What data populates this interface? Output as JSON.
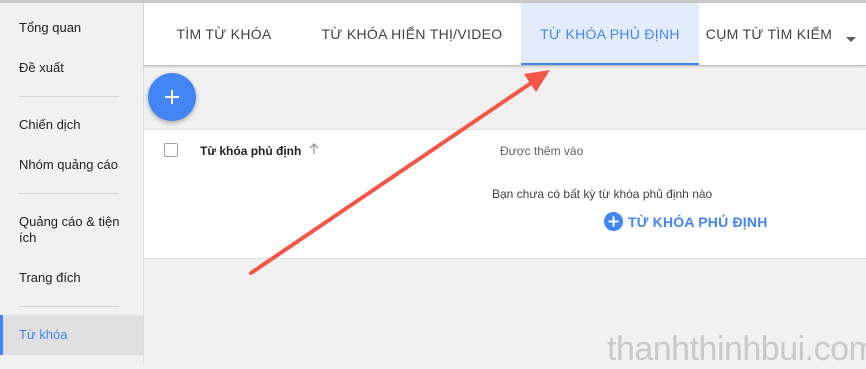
{
  "sidebar": {
    "items": [
      {
        "label": "Tổng quan"
      },
      {
        "label": "Đề xuất"
      },
      {
        "label": "Chiến dịch"
      },
      {
        "label": "Nhóm quảng cáo"
      },
      {
        "label": "Quảng cáo & tiện ích"
      },
      {
        "label": "Trang đích"
      },
      {
        "label": "Từ khóa"
      }
    ],
    "active_index": 6
  },
  "tabs": [
    {
      "label": "TÌM TỪ KHÓA"
    },
    {
      "label": "TỪ KHÓA HIỂN THỊ/VIDEO"
    },
    {
      "label": "TỪ KHÓA PHỦ ĐỊNH"
    },
    {
      "label": "CỤM TỪ TÌM KIẾM"
    }
  ],
  "active_tab_index": 2,
  "table": {
    "columns": [
      "Từ khóa phủ định",
      "Được thêm vào"
    ]
  },
  "empty_state": {
    "message": "Bạn chưa có bất kỳ từ khóa phủ định nào",
    "add_label": "TỪ KHÓA PHỦ ĐỊNH"
  },
  "watermark": "thanhthinhbui.com",
  "colors": {
    "accent": "#4285f4",
    "annotation_arrow": "#f4564a"
  },
  "icons": {
    "fab": "plus-icon",
    "sort": "arrow-up-icon",
    "tab_more": "triangle-down-icon"
  }
}
